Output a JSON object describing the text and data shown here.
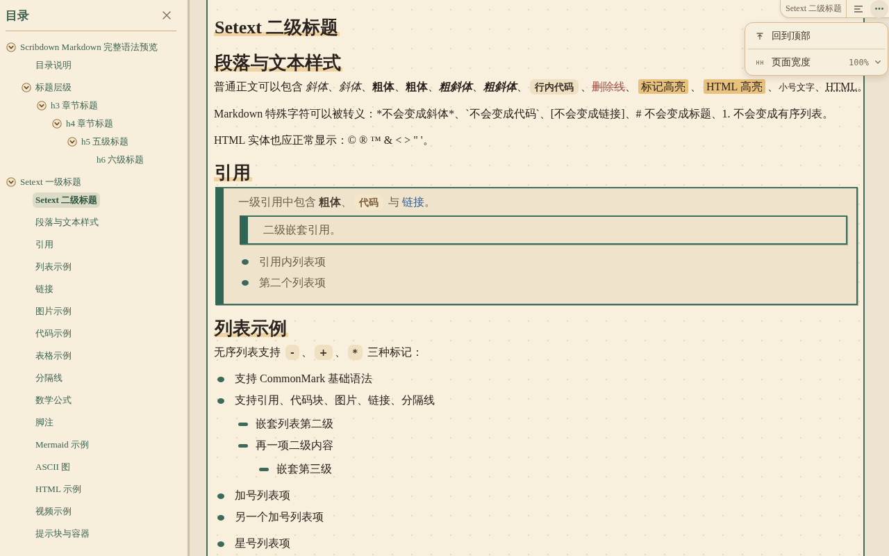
{
  "sidebar": {
    "title": "目录",
    "toc": [
      {
        "label": "Scribdown Markdown 完整语法预览",
        "selected": false,
        "expanded": true,
        "children": [
          {
            "label": "目录说明",
            "selected": false
          },
          {
            "label": "标题层级",
            "selected": false,
            "expanded": true,
            "children": [
              {
                "label": "h3 章节标题",
                "selected": false,
                "expanded": true,
                "children": [
                  {
                    "label": "h4 章节标题",
                    "selected": false,
                    "expanded": true,
                    "children": [
                      {
                        "label": "h5 五级标题",
                        "selected": false,
                        "expanded": true,
                        "children": [
                          {
                            "label": "h6 六级标题",
                            "selected": false
                          }
                        ]
                      }
                    ]
                  }
                ]
              }
            ]
          }
        ]
      },
      {
        "label": "Setext 一级标题",
        "selected": false,
        "expanded": true,
        "children": [
          {
            "label": "Setext 二级标题",
            "selected": true
          },
          {
            "label": "段落与文本样式",
            "selected": false
          },
          {
            "label": "引用",
            "selected": false
          },
          {
            "label": "列表示例",
            "selected": false
          },
          {
            "label": "链接",
            "selected": false
          },
          {
            "label": "图片示例",
            "selected": false
          },
          {
            "label": "代码示例",
            "selected": false
          },
          {
            "label": "表格示例",
            "selected": false
          },
          {
            "label": "分隔线",
            "selected": false
          },
          {
            "label": "数学公式",
            "selected": false
          },
          {
            "label": "脚注",
            "selected": false
          },
          {
            "label": "Mermaid 示例",
            "selected": false
          },
          {
            "label": "ASCII 图",
            "selected": false
          },
          {
            "label": "HTML 示例",
            "selected": false
          },
          {
            "label": "视频示例",
            "selected": false
          },
          {
            "label": "提示块与容器",
            "selected": false
          }
        ]
      }
    ]
  },
  "toolbar": {
    "current_section": "Setext 二级标题"
  },
  "menu": {
    "items": [
      {
        "kind": "action",
        "label": "回到顶部"
      },
      {
        "kind": "select",
        "label": "页面宽度",
        "value": "100%"
      }
    ]
  },
  "document": {
    "blocks": [
      {
        "kind": "heading",
        "text": "Setext 二级标题"
      },
      {
        "kind": "heading",
        "text": "段落与文本样式"
      },
      {
        "kind": "paragraph",
        "runs": [
          {
            "kind": "text",
            "text": "普通正文可以包含 "
          },
          {
            "kind": "italic",
            "text": "斜体"
          },
          {
            "kind": "text",
            "text": "、"
          },
          {
            "kind": "italic",
            "text": "斜体"
          },
          {
            "kind": "text",
            "text": "、"
          },
          {
            "kind": "bold",
            "text": "粗体"
          },
          {
            "kind": "text",
            "text": "、"
          },
          {
            "kind": "bold",
            "text": "粗体"
          },
          {
            "kind": "text",
            "text": "、"
          },
          {
            "kind": "bold_italic",
            "text": "粗斜体"
          },
          {
            "kind": "text",
            "text": "、"
          },
          {
            "kind": "bold_italic",
            "text": "粗斜体"
          },
          {
            "kind": "text",
            "text": "、"
          },
          {
            "kind": "code",
            "text": "行内代码"
          },
          {
            "kind": "text",
            "text": "、"
          },
          {
            "kind": "strike",
            "text": "删除线"
          },
          {
            "kind": "text",
            "text": "、"
          },
          {
            "kind": "mark",
            "text": "标记高亮"
          },
          {
            "kind": "text",
            "text": "、"
          },
          {
            "kind": "mark",
            "text": "HTML 高亮"
          },
          {
            "kind": "text",
            "text": "、"
          },
          {
            "kind": "small",
            "text": "小号文字"
          },
          {
            "kind": "text",
            "text": "、"
          },
          {
            "kind": "abbr",
            "text": "HTML"
          },
          {
            "kind": "text",
            "text": "。"
          }
        ]
      },
      {
        "kind": "paragraph",
        "runs": [
          {
            "kind": "text",
            "text": "Markdown 特殊字符可以被转义：*不会变成斜体*、`不会变成代码`、[不会变成链接]、# 不会变成标题、1. 不会变成有序列表。"
          }
        ]
      },
      {
        "kind": "paragraph",
        "runs": [
          {
            "kind": "text",
            "text": "HTML 实体也应正常显示：© ® ™ & < > \" '。"
          }
        ]
      },
      {
        "kind": "heading",
        "text": "引用"
      },
      {
        "kind": "blockquote",
        "blocks": [
          {
            "kind": "paragraph",
            "runs": [
              {
                "kind": "text",
                "text": "一级引用中包含 "
              },
              {
                "kind": "bold",
                "text": "粗体"
              },
              {
                "kind": "text",
                "text": "、"
              },
              {
                "kind": "code",
                "text": "代码"
              },
              {
                "kind": "text",
                "text": " 与 "
              },
              {
                "kind": "link",
                "text": "链接"
              },
              {
                "kind": "text",
                "text": "。"
              }
            ]
          },
          {
            "kind": "blockquote",
            "blocks": [
              {
                "kind": "paragraph",
                "runs": [
                  {
                    "kind": "text",
                    "text": "二级嵌套引用。"
                  }
                ]
              }
            ]
          },
          {
            "kind": "list",
            "items": [
              {
                "text": "引用内列表项"
              },
              {
                "text": "第二个列表项"
              }
            ]
          }
        ]
      },
      {
        "kind": "heading",
        "text": "列表示例"
      },
      {
        "kind": "paragraph",
        "runs": [
          {
            "kind": "text",
            "text": "无序列表支持 "
          },
          {
            "kind": "code",
            "text": "-"
          },
          {
            "kind": "text",
            "text": "、"
          },
          {
            "kind": "code",
            "text": "+"
          },
          {
            "kind": "text",
            "text": "、"
          },
          {
            "kind": "code",
            "text": "*"
          },
          {
            "kind": "text",
            "text": " 三种标记："
          }
        ]
      },
      {
        "kind": "list",
        "items": [
          {
            "text": "支持 CommonMark 基础语法"
          },
          {
            "text": "支持引用、代码块、图片、链接、分隔线",
            "children": [
              {
                "text": "嵌套列表第二级"
              },
              {
                "text": "再一项二级内容",
                "children": [
                  {
                    "text": "嵌套第三级"
                  }
                ]
              }
            ]
          }
        ]
      },
      {
        "kind": "list",
        "items": [
          {
            "text": "加号列表项"
          },
          {
            "text": "另一个加号列表项"
          }
        ]
      },
      {
        "kind": "list",
        "items": [
          {
            "text": "星号列表项"
          }
        ]
      }
    ]
  }
}
